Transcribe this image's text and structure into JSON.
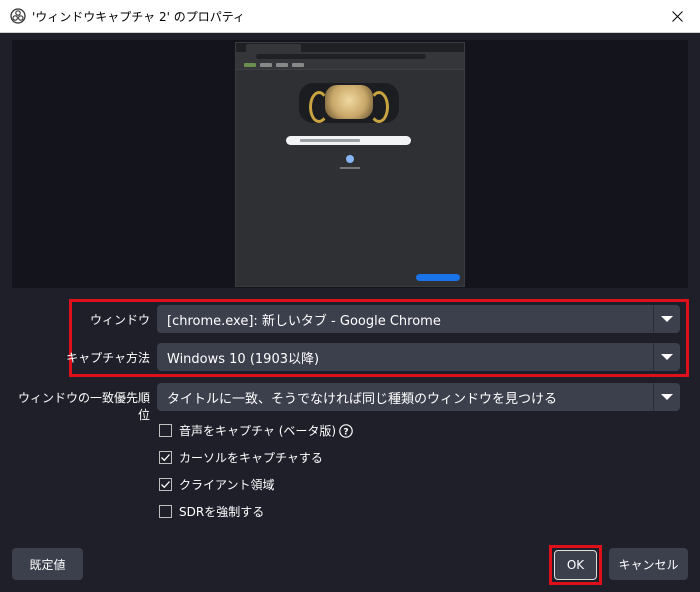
{
  "window": {
    "title": "'ウィンドウキャプチャ 2' のプロパティ"
  },
  "fields": {
    "window_label": "ウィンドウ",
    "window_value": "[chrome.exe]: 新しいタブ - Google Chrome",
    "capture_method_label": "キャプチャ方法",
    "capture_method_value": "Windows 10 (1903以降)",
    "priority_label": "ウィンドウの一致優先順位",
    "priority_value": "タイトルに一致、そうでなければ同じ種類のウィンドウを見つける"
  },
  "options": [
    {
      "label": "音声をキャプチャ (ベータ版)",
      "checked": false
    },
    {
      "label": "カーソルをキャプチャする",
      "checked": true
    },
    {
      "label": "クライアント領域",
      "checked": true
    },
    {
      "label": "SDRを強制する",
      "checked": false
    }
  ],
  "buttons": {
    "defaults": "既定値",
    "ok": "OK",
    "cancel": "キャンセル"
  },
  "colors": {
    "highlight": "#e0101a",
    "background": "#1e1f29",
    "control": "#3c404d"
  }
}
